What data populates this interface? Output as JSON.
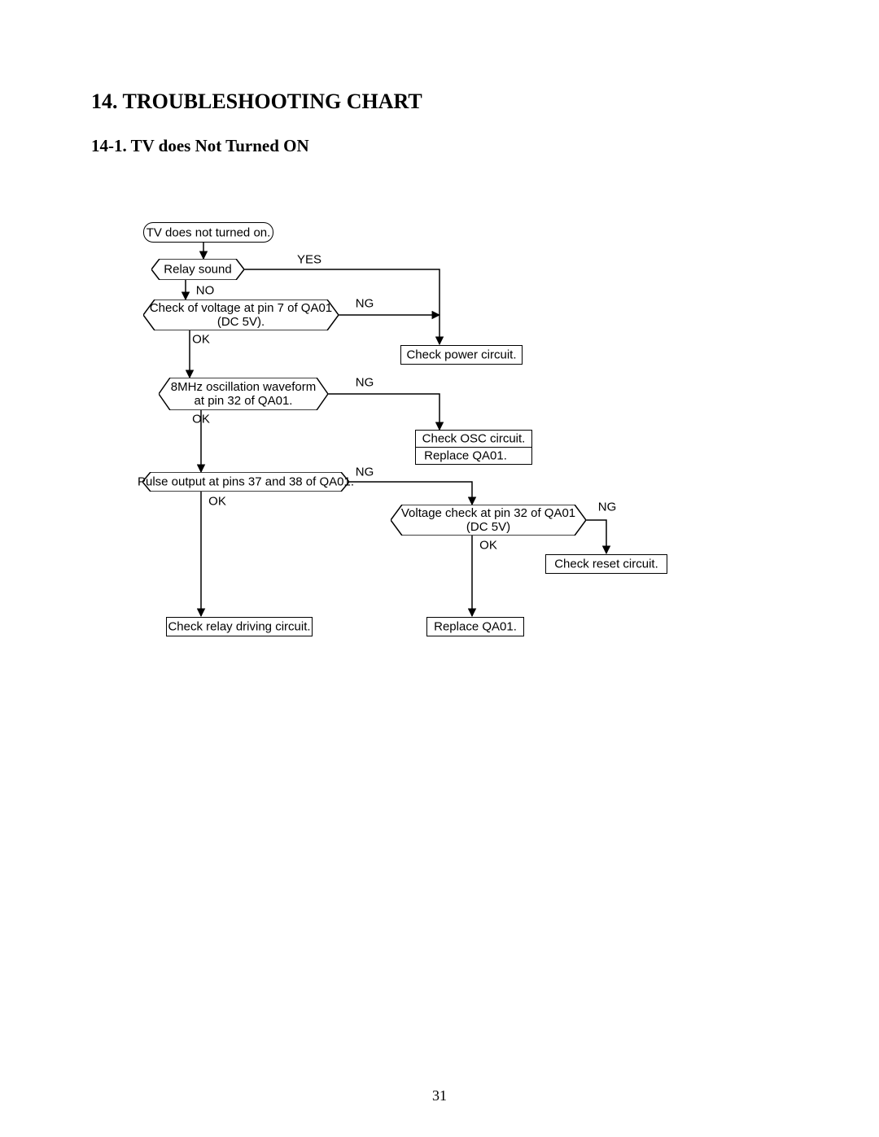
{
  "heading": {
    "title": "14.   TROUBLESHOOTING CHART",
    "subtitle": "14-1. TV does Not Turned ON"
  },
  "labels": {
    "yes": "YES",
    "no": "NO",
    "ok": "OK",
    "ng": "NG"
  },
  "nodes": {
    "start": "TV does not turned on.",
    "relay_sound": "Relay sound",
    "check_pin7": "Check of voltage at pin 7 of QA01\n(DC 5V).",
    "check_power": "Check power circuit.",
    "osc_wave": "8MHz oscillation waveform\nat pin 32 of QA01.",
    "check_osc": "Check OSC circuit.",
    "replace_qa01_a": "Replace QA01.",
    "pulse_out": "Pulse output at pins 37 and 38 of QA01.",
    "volt_pin32": "Voltage check at pin 32 of QA01\n(DC 5V)",
    "check_reset": "Check reset circuit.",
    "check_relay_drv": "Check relay driving circuit.",
    "replace_qa01_b": "Replace QA01."
  },
  "page_number": "31"
}
